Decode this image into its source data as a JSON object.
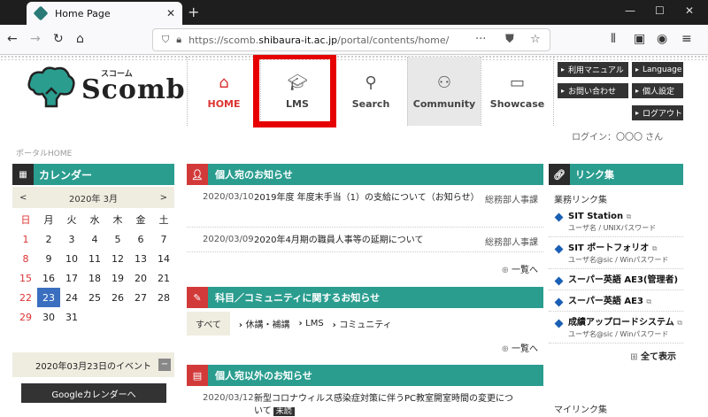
{
  "browser": {
    "tab_title": "Home Page",
    "url_prefix": "https://scomb.",
    "url_domain": "shibaura-it.ac.jp",
    "url_path": "/portal/contents/home/"
  },
  "header": {
    "logo_text": "Scomb",
    "logo_kana": "スコーム",
    "nav": [
      {
        "label": "HOME",
        "icon": "home-icon"
      },
      {
        "label": "LMS",
        "icon": "graduation-cap-icon"
      },
      {
        "label": "Search",
        "icon": "search-icon"
      },
      {
        "label": "Community",
        "icon": "people-icon"
      },
      {
        "label": "Showcase",
        "icon": "folder-icon"
      }
    ],
    "util_buttons": {
      "manual": "利用マニュアル",
      "language": "Language",
      "contact": "お問い合わせ",
      "settings": "個人設定",
      "logout": "ログアウト"
    },
    "login_text": "ログイン：〇〇〇 さん"
  },
  "breadcrumb": "ポータルHOME",
  "calendar": {
    "title": "カレンダー",
    "month": "2020年 3月",
    "weekdays": [
      "日",
      "月",
      "火",
      "水",
      "木",
      "金",
      "土"
    ],
    "days": [
      "1",
      "2",
      "3",
      "4",
      "5",
      "6",
      "7",
      "8",
      "9",
      "10",
      "11",
      "12",
      "13",
      "14",
      "15",
      "16",
      "17",
      "18",
      "19",
      "20",
      "21",
      "22",
      "23",
      "24",
      "25",
      "26",
      "27",
      "28",
      "29",
      "30",
      "31"
    ],
    "event_title": "2020年03月23日のイベント",
    "google_button": "Googleカレンダーへ"
  },
  "personal_notices": {
    "title": "個人宛のお知らせ",
    "items": [
      {
        "date": "2020/03/10",
        "text": "2019年度 年度末手当（1）の支給について（お知らせ）",
        "dept": "総務部人事課"
      },
      {
        "date": "2020/03/09",
        "text": "2020年4月期の職員人事等の延期について",
        "dept": "総務部人事課"
      }
    ],
    "more": "一覧へ"
  },
  "course_notices": {
    "title": "科目／コミュニティに関するお知らせ",
    "tabs": [
      "すべて",
      "休講・補講",
      "LMS",
      "コミュニティ"
    ],
    "more": "一覧へ"
  },
  "other_notices": {
    "title": "個人宛以外のお知らせ",
    "items": [
      {
        "date": "2020/03/12",
        "text": "新型コロナウィルス感染症対策に伴うPC教室開室時間の変更について",
        "badge": "未読"
      }
    ]
  },
  "links": {
    "title": "リンク集",
    "subtitle": "業務リンク集",
    "items": [
      {
        "name": "SIT Station",
        "sub": "ユーザ名 / UNIXパスワード"
      },
      {
        "name": "SIT ポートフォリオ",
        "sub": "ユーザ名@sic / Winパスワード"
      },
      {
        "name": "スーパー英語 AE3(管理者)",
        "sub": ""
      },
      {
        "name": "スーパー英語 AE3",
        "sub": ""
      },
      {
        "name": "成績アップロードシステム",
        "sub": "ユーザ名@sic / Winパスワード"
      }
    ],
    "show_all": "全て表示",
    "my_links": "マイリンク集"
  },
  "colors": {
    "teal": "#2a9d8f",
    "red_accent": "#d23a3a",
    "highlight": "#e60000",
    "today": "#3a6fc0"
  }
}
